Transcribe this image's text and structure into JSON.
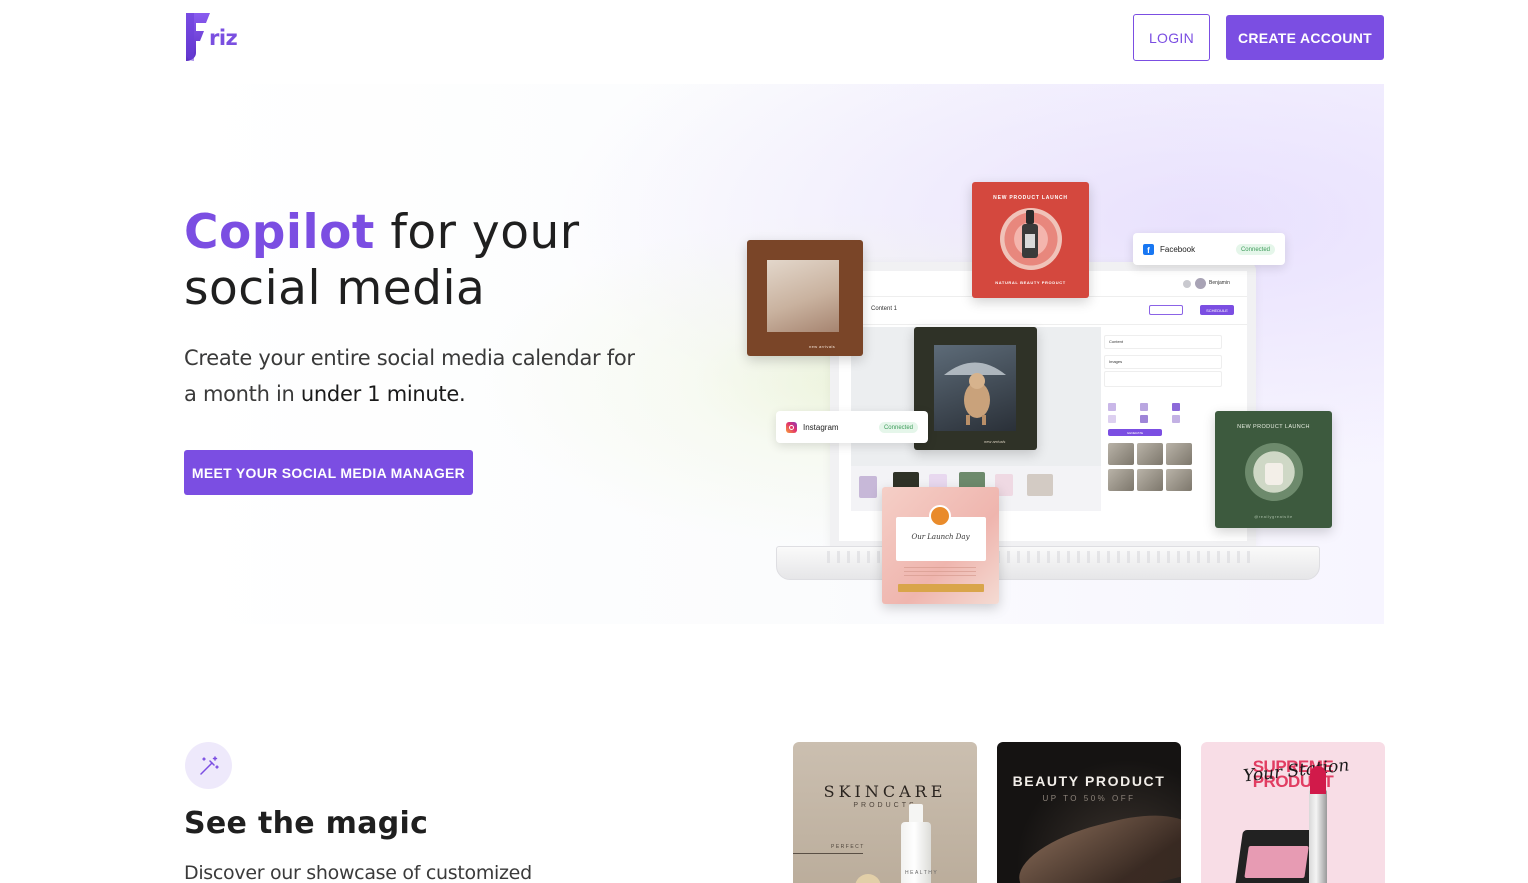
{
  "brand": {
    "logo_text": "riz",
    "accent": "#7b4ee2"
  },
  "header": {
    "login_label": "LOGIN",
    "create_account_label": "CREATE ACCOUNT"
  },
  "hero": {
    "title_accent": "Copilot",
    "title_rest_1": " for your",
    "title_rest_2": "social media",
    "subtitle_1": "Create your entire social media calendar for",
    "subtitle_2": "a month in ",
    "subtitle_emph": "under 1 minute.",
    "cta_label": "MEET YOUR SOCIAL MEDIA MANAGER"
  },
  "mockup": {
    "facebook": {
      "label": "Facebook",
      "status": "Connected",
      "icon": "facebook-icon"
    },
    "instagram": {
      "label": "Instagram",
      "status": "Connected",
      "icon": "instagram-icon"
    },
    "app": {
      "tab_label": "Content 1",
      "user_name": "Benjamin",
      "btn_schedule": "SCHEDULE",
      "panel_content": "Content",
      "panel_images": "Images",
      "btn_generate": "GENERATE"
    },
    "red_card": {
      "title": "NEW PRODUCT LAUNCH",
      "subtitle": "NATURAL BEAUTY PRODUCT"
    },
    "brown_card": {
      "caption": "new arrivals"
    },
    "cat_card": {
      "caption": "new arrivals"
    },
    "pink_card": {
      "script": "Our Launch Day"
    },
    "green_card": {
      "title": "NEW PRODUCT LAUNCH",
      "caption": "@reallygreatsite"
    }
  },
  "magic": {
    "icon": "magic-wand-icon",
    "title": "See the magic",
    "subtitle": "Discover our showcase of customized"
  },
  "showcase": [
    {
      "title": "SKINCARE",
      "subtitle": "PRODUCTS",
      "tag1": "PERFECT",
      "tag2": "HEALTHY"
    },
    {
      "title": "BEAUTY PRODUCT",
      "subtitle": "UP TO 50% OFF"
    },
    {
      "title_line1": "SUPREME",
      "title_line2": "PRODUCT",
      "script": "Your Station"
    }
  ]
}
